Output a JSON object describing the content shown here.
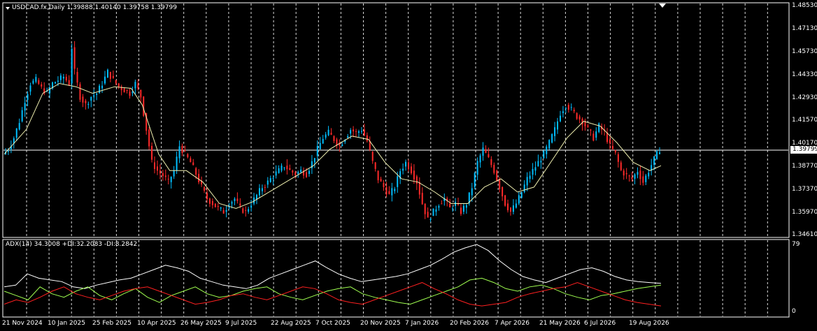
{
  "chart_header": {
    "symbol_text": "USDCAD.fx,Daily",
    "ohlc_text": "1.39888 1.40140 1.39758 1.39799",
    "menu_icon": "triangle-down-icon"
  },
  "indicator_header": {
    "text": "ADX(14) 34.3008 +DI:32.2083 -DI:8.2842"
  },
  "current_price": "1.39799",
  "colors": {
    "background": "#000000",
    "bull_candle": "#00bfff",
    "bear_candle": "#ff2a2a",
    "ma_line": "#f0f0b0",
    "adx_line": "#ffffff",
    "plus_di": "#a0ff50",
    "minus_di": "#ff2020",
    "grid": "#ffffff"
  },
  "chart_data": {
    "type": "line",
    "price_axis_ticks": [
      "1.48530",
      "1.47130",
      "1.45730",
      "1.44330",
      "1.42930",
      "1.41570",
      "1.40170",
      "1.38770",
      "1.37370",
      "1.35970",
      "1.34610"
    ],
    "indicator_axis_ticks": [
      "79",
      "0"
    ],
    "date_ticks": [
      "21 Nov 2024",
      "10 Jan 2025",
      "25 Feb 2025",
      "10 Apr 2025",
      "26 May 2025",
      "9 Jul 2025",
      "22 Aug 2025",
      "7 Oct 2025",
      "20 Nov 2025",
      "7 Jan 2026",
      "20 Feb 2026",
      "7 Apr 2026",
      "21 May 2026",
      "6 Jul 2026",
      "19 Aug 2026"
    ],
    "price_range": [
      1.3461,
      1.4853
    ],
    "indicator_range": [
      0,
      79
    ],
    "price_path": [
      [
        0,
        1.395
      ],
      [
        2,
        1.398
      ],
      [
        4,
        1.405
      ],
      [
        6,
        1.415
      ],
      [
        8,
        1.428
      ],
      [
        10,
        1.438
      ],
      [
        12,
        1.44
      ],
      [
        14,
        1.435
      ],
      [
        16,
        1.432
      ],
      [
        18,
        1.438
      ],
      [
        20,
        1.44
      ],
      [
        22,
        1.442
      ],
      [
        24,
        1.438
      ],
      [
        25,
        1.46
      ],
      [
        26,
        1.445
      ],
      [
        28,
        1.43
      ],
      [
        30,
        1.425
      ],
      [
        32,
        1.43
      ],
      [
        34,
        1.432
      ],
      [
        36,
        1.438
      ],
      [
        38,
        1.445
      ],
      [
        40,
        1.44
      ],
      [
        42,
        1.436
      ],
      [
        44,
        1.434
      ],
      [
        46,
        1.432
      ],
      [
        48,
        1.438
      ],
      [
        50,
        1.43
      ],
      [
        52,
        1.41
      ],
      [
        54,
        1.39
      ],
      [
        56,
        1.385
      ],
      [
        58,
        1.382
      ],
      [
        60,
        1.378
      ],
      [
        62,
        1.385
      ],
      [
        64,
        1.4
      ],
      [
        66,
        1.395
      ],
      [
        68,
        1.39
      ],
      [
        70,
        1.383
      ],
      [
        72,
        1.375
      ],
      [
        74,
        1.368
      ],
      [
        76,
        1.365
      ],
      [
        78,
        1.362
      ],
      [
        80,
        1.36
      ],
      [
        82,
        1.365
      ],
      [
        84,
        1.368
      ],
      [
        86,
        1.362
      ],
      [
        88,
        1.36
      ],
      [
        90,
        1.365
      ],
      [
        92,
        1.37
      ],
      [
        94,
        1.375
      ],
      [
        96,
        1.378
      ],
      [
        98,
        1.382
      ],
      [
        100,
        1.385
      ],
      [
        102,
        1.388
      ],
      [
        104,
        1.385
      ],
      [
        106,
        1.383
      ],
      [
        108,
        1.385
      ],
      [
        110,
        1.383
      ],
      [
        112,
        1.39
      ],
      [
        114,
        1.398
      ],
      [
        116,
        1.405
      ],
      [
        118,
        1.408
      ],
      [
        120,
        1.404
      ],
      [
        122,
        1.4
      ],
      [
        124,
        1.405
      ],
      [
        126,
        1.41
      ],
      [
        128,
        1.408
      ],
      [
        130,
        1.41
      ],
      [
        132,
        1.403
      ],
      [
        134,
        1.39
      ],
      [
        136,
        1.38
      ],
      [
        138,
        1.375
      ],
      [
        140,
        1.37
      ],
      [
        142,
        1.375
      ],
      [
        144,
        1.385
      ],
      [
        146,
        1.39
      ],
      [
        148,
        1.385
      ],
      [
        150,
        1.378
      ],
      [
        152,
        1.365
      ],
      [
        154,
        1.355
      ],
      [
        156,
        1.36
      ],
      [
        158,
        1.365
      ],
      [
        160,
        1.368
      ],
      [
        162,
        1.362
      ],
      [
        164,
        1.365
      ],
      [
        166,
        1.36
      ],
      [
        168,
        1.365
      ],
      [
        170,
        1.375
      ],
      [
        172,
        1.39
      ],
      [
        174,
        1.398
      ],
      [
        176,
        1.392
      ],
      [
        178,
        1.385
      ],
      [
        180,
        1.375
      ],
      [
        182,
        1.365
      ],
      [
        184,
        1.36
      ],
      [
        186,
        1.365
      ],
      [
        188,
        1.372
      ],
      [
        190,
        1.38
      ],
      [
        192,
        1.385
      ],
      [
        194,
        1.39
      ],
      [
        196,
        1.395
      ],
      [
        198,
        1.402
      ],
      [
        200,
        1.41
      ],
      [
        202,
        1.42
      ],
      [
        204,
        1.425
      ],
      [
        206,
        1.422
      ],
      [
        208,
        1.418
      ],
      [
        210,
        1.415
      ],
      [
        212,
        1.41
      ],
      [
        214,
        1.405
      ],
      [
        216,
        1.412
      ],
      [
        218,
        1.408
      ],
      [
        220,
        1.4
      ],
      [
        222,
        1.395
      ],
      [
        224,
        1.385
      ],
      [
        226,
        1.382
      ],
      [
        228,
        1.38
      ],
      [
        230,
        1.385
      ],
      [
        232,
        1.378
      ],
      [
        234,
        1.385
      ],
      [
        236,
        1.392
      ],
      [
        238,
        1.398
      ]
    ],
    "ma_path": [
      [
        0,
        1.395
      ],
      [
        8,
        1.41
      ],
      [
        14,
        1.432
      ],
      [
        20,
        1.438
      ],
      [
        26,
        1.436
      ],
      [
        32,
        1.432
      ],
      [
        40,
        1.436
      ],
      [
        46,
        1.435
      ],
      [
        50,
        1.425
      ],
      [
        56,
        1.395
      ],
      [
        60,
        1.385
      ],
      [
        66,
        1.385
      ],
      [
        72,
        1.378
      ],
      [
        78,
        1.365
      ],
      [
        84,
        1.362
      ],
      [
        90,
        1.366
      ],
      [
        98,
        1.374
      ],
      [
        106,
        1.382
      ],
      [
        112,
        1.388
      ],
      [
        118,
        1.398
      ],
      [
        126,
        1.406
      ],
      [
        132,
        1.404
      ],
      [
        138,
        1.39
      ],
      [
        144,
        1.38
      ],
      [
        150,
        1.378
      ],
      [
        156,
        1.372
      ],
      [
        162,
        1.365
      ],
      [
        168,
        1.365
      ],
      [
        174,
        1.375
      ],
      [
        180,
        1.38
      ],
      [
        186,
        1.372
      ],
      [
        192,
        1.375
      ],
      [
        198,
        1.39
      ],
      [
        204,
        1.405
      ],
      [
        210,
        1.415
      ],
      [
        216,
        1.412
      ],
      [
        222,
        1.402
      ],
      [
        228,
        1.39
      ],
      [
        234,
        1.385
      ],
      [
        238,
        1.388
      ]
    ],
    "adx_series": [
      30,
      32,
      45,
      40,
      38,
      36,
      30,
      28,
      32,
      35,
      38,
      40,
      45,
      50,
      55,
      52,
      48,
      40,
      36,
      32,
      30,
      28,
      32,
      40,
      45,
      50,
      55,
      60,
      52,
      45,
      40,
      36,
      38,
      40,
      42,
      45,
      50,
      55,
      62,
      70,
      75,
      79,
      72,
      60,
      50,
      42,
      38,
      35,
      40,
      45,
      50,
      52,
      48,
      42,
      38,
      36,
      35,
      34
    ],
    "plus_di_series": [
      25,
      20,
      15,
      30,
      22,
      18,
      25,
      30,
      20,
      15,
      22,
      28,
      18,
      12,
      20,
      25,
      30,
      22,
      18,
      20,
      25,
      28,
      30,
      22,
      18,
      15,
      20,
      25,
      28,
      30,
      22,
      18,
      15,
      12,
      10,
      15,
      20,
      25,
      30,
      38,
      40,
      35,
      28,
      25,
      30,
      32,
      28,
      22,
      18,
      15,
      20,
      22,
      25,
      28,
      30,
      32
    ],
    "minus_di_series": [
      10,
      15,
      12,
      18,
      25,
      30,
      22,
      18,
      15,
      20,
      25,
      28,
      30,
      25,
      20,
      15,
      10,
      12,
      15,
      20,
      22,
      18,
      15,
      20,
      25,
      30,
      28,
      22,
      15,
      12,
      10,
      15,
      20,
      25,
      30,
      35,
      28,
      22,
      15,
      10,
      8,
      10,
      12,
      18,
      22,
      25,
      28,
      30,
      35,
      30,
      25,
      20,
      15,
      12,
      10,
      8
    ]
  }
}
